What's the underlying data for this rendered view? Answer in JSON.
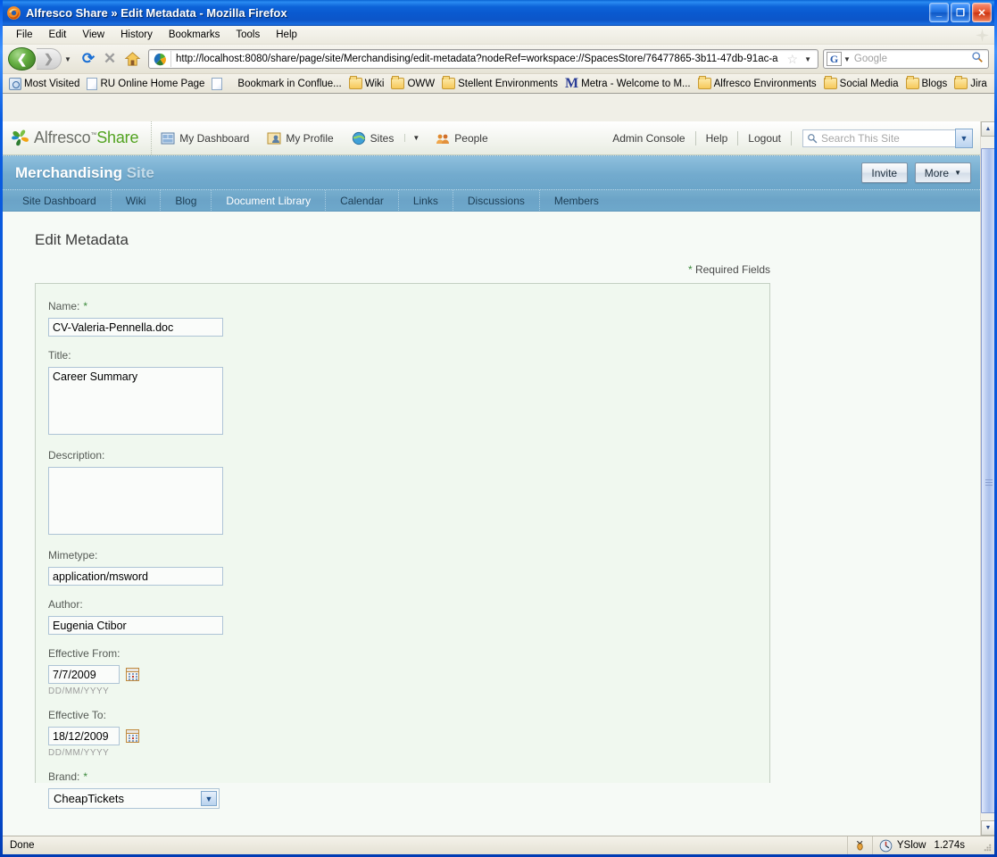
{
  "window": {
    "title": "Alfresco Share » Edit Metadata - Mozilla Firefox",
    "minimize_label": "_",
    "maximize_label": "❐",
    "close_label": "✕"
  },
  "menubar": {
    "items": [
      {
        "label": "File"
      },
      {
        "label": "Edit"
      },
      {
        "label": "View"
      },
      {
        "label": "History"
      },
      {
        "label": "Bookmarks"
      },
      {
        "label": "Tools"
      },
      {
        "label": "Help"
      }
    ]
  },
  "toolbar": {
    "back_glyph": "❮",
    "forward_glyph": "❯",
    "history_caret": "▼",
    "reload_glyph": "⟳",
    "stop_glyph": "✕",
    "home_glyph": "⌂",
    "url": "http://localhost:8080/share/page/site/Merchandising/edit-metadata?nodeRef=workspace://SpacesStore/76477865-3b11-47db-91ac-a",
    "star_glyph": "☆",
    "url_caret": "▼",
    "search_engine": "G",
    "search_caret": "▼",
    "search_placeholder": "Google",
    "search_magnifier": "🔍"
  },
  "bookmarks": {
    "items": [
      {
        "label": "Most Visited",
        "icon": "most-visited-icon"
      },
      {
        "label": "RU Online Home Page",
        "icon": "page-icon"
      },
      {
        "label": "Bookmark in Conflue...",
        "icon": "page-icon"
      },
      {
        "label": "Wiki",
        "icon": "folder-icon"
      },
      {
        "label": "OWW",
        "icon": "folder-icon"
      },
      {
        "label": "Stellent Environments",
        "icon": "folder-icon"
      },
      {
        "label": "Metra - Welcome to M...",
        "icon": "metra-icon"
      },
      {
        "label": "Alfresco Environments",
        "icon": "folder-icon"
      },
      {
        "label": "Social Media",
        "icon": "folder-icon"
      },
      {
        "label": "Blogs",
        "icon": "folder-icon"
      },
      {
        "label": "Jira",
        "icon": "folder-icon"
      }
    ],
    "overflow_glyph": "»"
  },
  "alfresco_header": {
    "logo_text_1": "Alfresco",
    "logo_tm": "™",
    "logo_text_2": "Share",
    "nav": [
      {
        "label": "My Dashboard",
        "icon": "dashboard-icon"
      },
      {
        "label": "My Profile",
        "icon": "profile-icon"
      },
      {
        "label": "Sites",
        "icon": "globe-icon"
      }
    ],
    "sites_caret": "▼",
    "people": {
      "label": "People",
      "icon": "people-icon"
    },
    "right_links": [
      {
        "label": "Admin Console"
      },
      {
        "label": "Help"
      },
      {
        "label": "Logout"
      }
    ],
    "search_placeholder": "Search This Site",
    "search_caret": "▼",
    "search_icon": "search-icon"
  },
  "site": {
    "name": "Merchandising",
    "suffix": "Site",
    "invite_label": "Invite",
    "more_label": "More",
    "more_caret": "▼",
    "tabs": [
      {
        "label": "Site Dashboard",
        "active": false
      },
      {
        "label": "Wiki",
        "active": false
      },
      {
        "label": "Blog",
        "active": false
      },
      {
        "label": "Document Library",
        "active": true
      },
      {
        "label": "Calendar",
        "active": false
      },
      {
        "label": "Links",
        "active": false
      },
      {
        "label": "Discussions",
        "active": false
      },
      {
        "label": "Members",
        "active": false
      }
    ]
  },
  "form": {
    "heading": "Edit Metadata",
    "required_note": "Required Fields",
    "required_star": "*",
    "fields": {
      "name": {
        "label": "Name:",
        "required": true,
        "value": "CV-Valeria-Pennella.doc"
      },
      "title": {
        "label": "Title:",
        "required": false,
        "value": "Career Summary"
      },
      "description": {
        "label": "Description:",
        "required": false,
        "value": ""
      },
      "mimetype": {
        "label": "Mimetype:",
        "required": false,
        "value": "application/msword"
      },
      "author": {
        "label": "Author:",
        "required": false,
        "value": "Eugenia Ctibor"
      },
      "effective_from": {
        "label": "Effective From:",
        "required": false,
        "value": "7/7/2009",
        "hint": "DD/MM/YYYY",
        "calendar_icon": "calendar-icon"
      },
      "effective_to": {
        "label": "Effective To:",
        "required": false,
        "value": "18/12/2009",
        "hint": "DD/MM/YYYY",
        "calendar_icon": "calendar-icon"
      },
      "brand": {
        "label": "Brand:",
        "required": true,
        "value": "CheapTickets",
        "caret": "▼"
      }
    }
  },
  "scrollbar": {
    "up_glyph": "▲",
    "down_glyph": "▼"
  },
  "statusbar": {
    "status": "Done",
    "yslow_label": "YSlow",
    "yslow_time": "1.274s"
  }
}
